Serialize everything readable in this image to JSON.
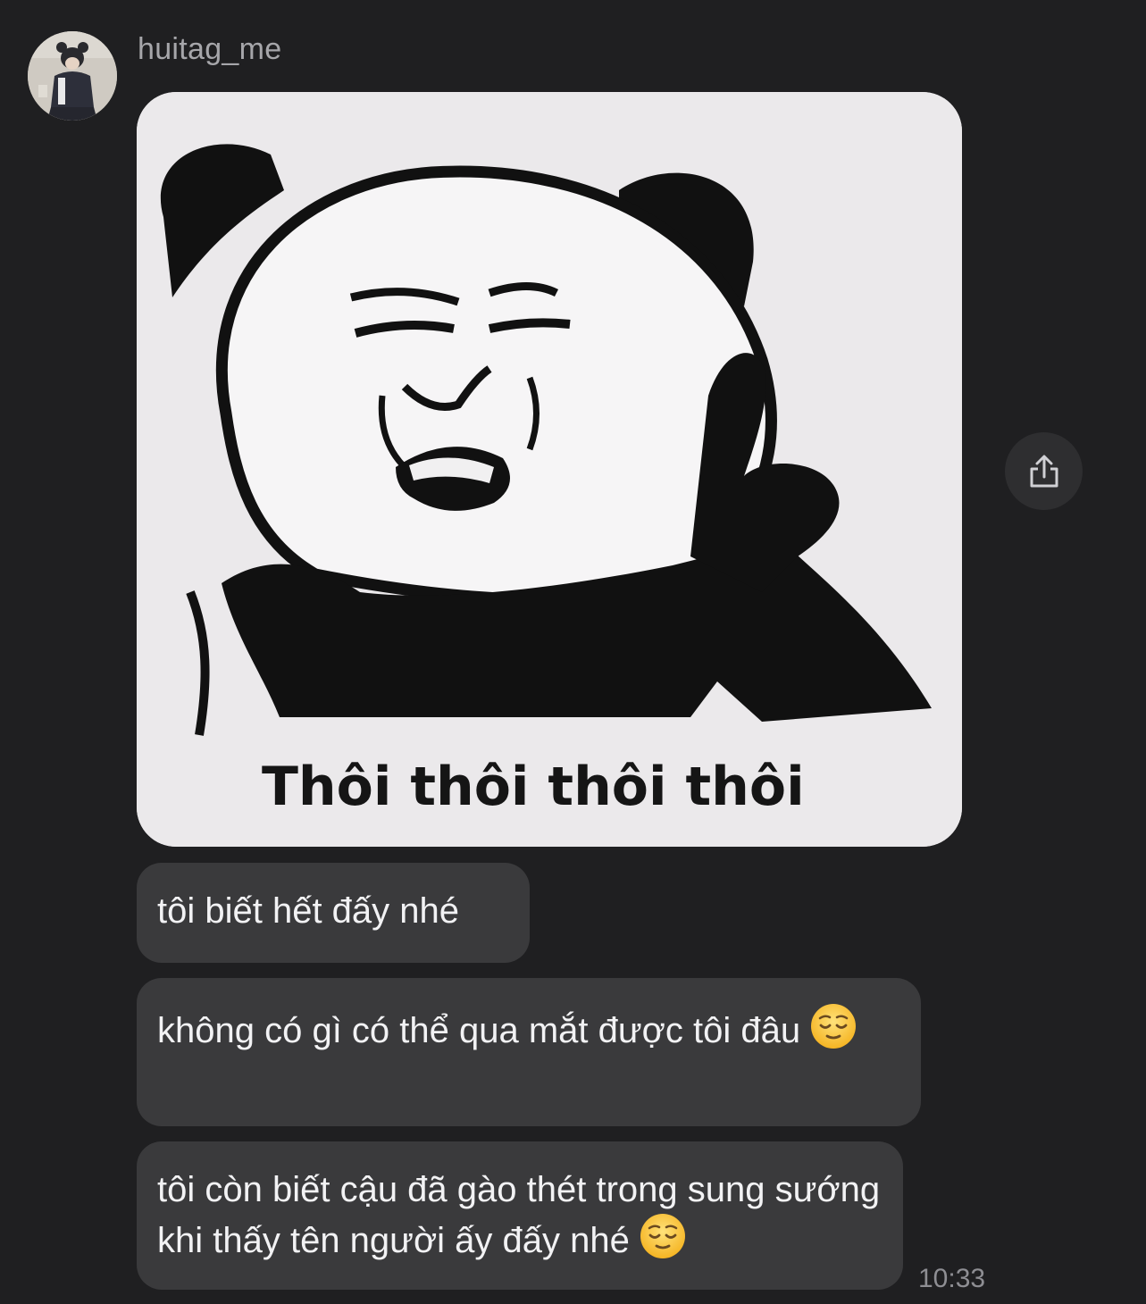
{
  "conversation": {
    "sender_name": "huitag_me",
    "sticker": {
      "caption": "Thôi thôi thôi thôi"
    },
    "messages": [
      {
        "text": "tôi biết hết đấy nhé",
        "emoji": ""
      },
      {
        "text": "không có gì có thể qua mắt được tôi đâu",
        "emoji": "relieved-face"
      },
      {
        "text": "tôi còn biết cậu đã gào thét trong sung sướng khi thấy tên người ấy đấy nhé",
        "emoji": "relieved-face"
      }
    ],
    "timestamp": "10:33",
    "share_icon": "share-icon"
  }
}
